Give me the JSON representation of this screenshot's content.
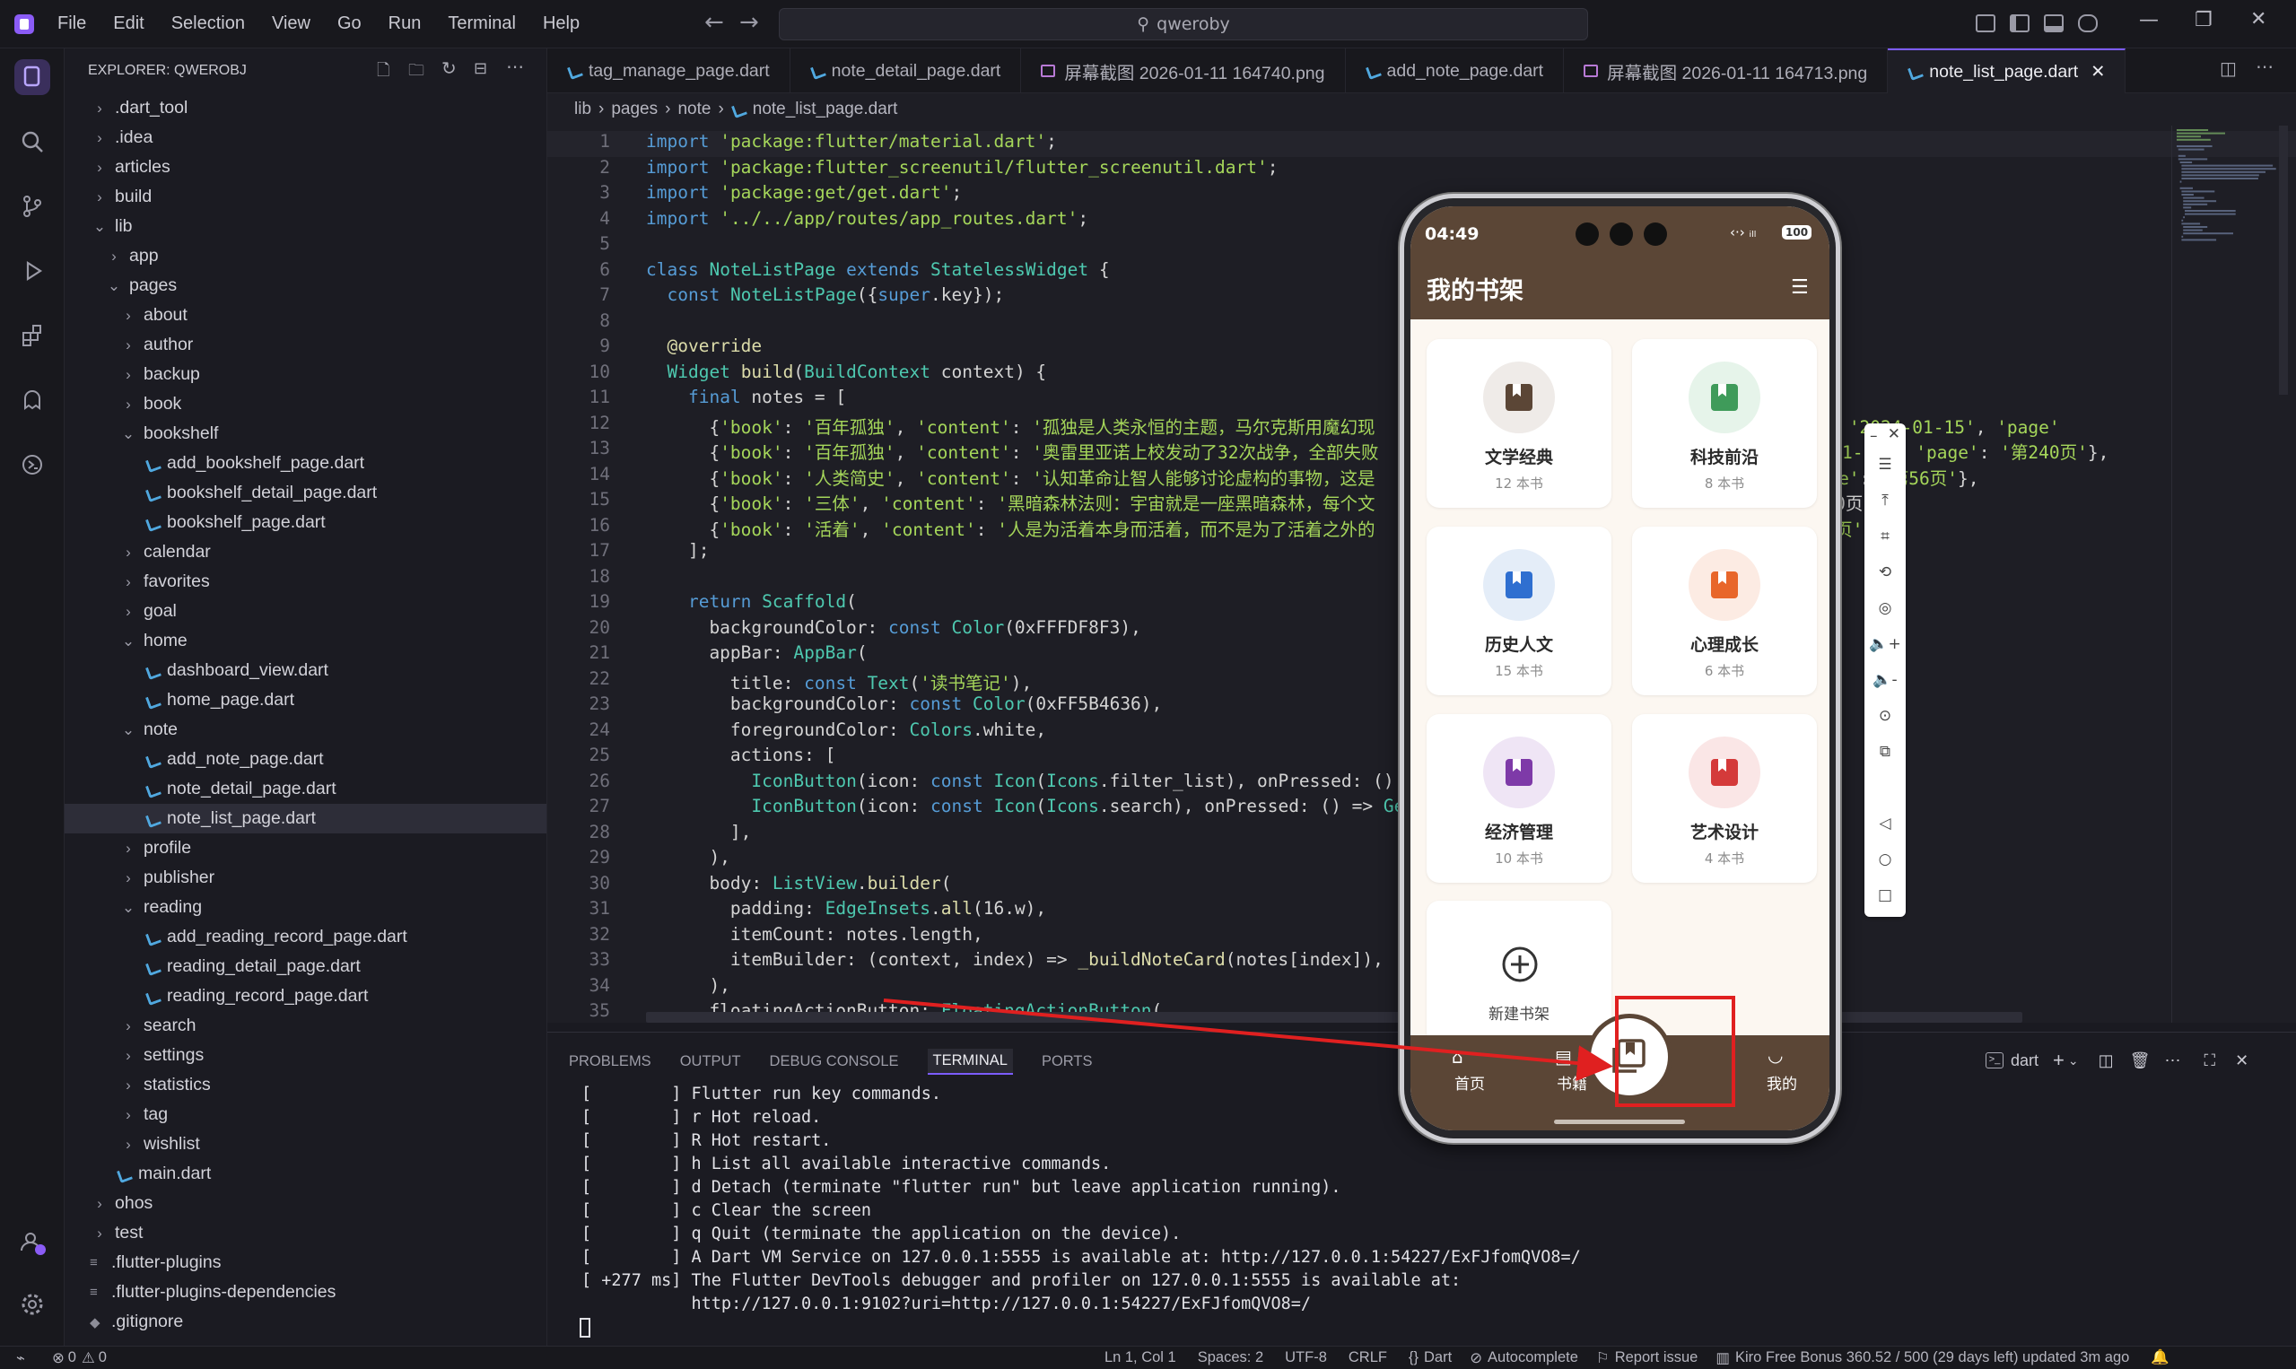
{
  "menu": [
    "File",
    "Edit",
    "Selection",
    "View",
    "Go",
    "Run",
    "Terminal",
    "Help"
  ],
  "search": {
    "text": "qweroby"
  },
  "explorer": {
    "title": "EXPLORER: QWEROBJ",
    "items": [
      {
        "label": ".dart_tool",
        "depth": 0,
        "type": "folder",
        "open": false
      },
      {
        "label": ".idea",
        "depth": 0,
        "type": "folder",
        "open": false
      },
      {
        "label": "articles",
        "depth": 0,
        "type": "folder",
        "open": false
      },
      {
        "label": "build",
        "depth": 0,
        "type": "folder",
        "open": false
      },
      {
        "label": "lib",
        "depth": 0,
        "type": "folder",
        "open": true
      },
      {
        "label": "app",
        "depth": 1,
        "type": "folder",
        "open": false
      },
      {
        "label": "pages",
        "depth": 1,
        "type": "folder",
        "open": true
      },
      {
        "label": "about",
        "depth": 2,
        "type": "folder",
        "open": false
      },
      {
        "label": "author",
        "depth": 2,
        "type": "folder",
        "open": false
      },
      {
        "label": "backup",
        "depth": 2,
        "type": "folder",
        "open": false
      },
      {
        "label": "book",
        "depth": 2,
        "type": "folder",
        "open": false
      },
      {
        "label": "bookshelf",
        "depth": 2,
        "type": "folder",
        "open": true
      },
      {
        "label": "add_bookshelf_page.dart",
        "depth": 3,
        "type": "dart"
      },
      {
        "label": "bookshelf_detail_page.dart",
        "depth": 3,
        "type": "dart"
      },
      {
        "label": "bookshelf_page.dart",
        "depth": 3,
        "type": "dart"
      },
      {
        "label": "calendar",
        "depth": 2,
        "type": "folder",
        "open": false
      },
      {
        "label": "favorites",
        "depth": 2,
        "type": "folder",
        "open": false
      },
      {
        "label": "goal",
        "depth": 2,
        "type": "folder",
        "open": false
      },
      {
        "label": "home",
        "depth": 2,
        "type": "folder",
        "open": true
      },
      {
        "label": "dashboard_view.dart",
        "depth": 3,
        "type": "dart"
      },
      {
        "label": "home_page.dart",
        "depth": 3,
        "type": "dart"
      },
      {
        "label": "note",
        "depth": 2,
        "type": "folder",
        "open": true
      },
      {
        "label": "add_note_page.dart",
        "depth": 3,
        "type": "dart"
      },
      {
        "label": "note_detail_page.dart",
        "depth": 3,
        "type": "dart"
      },
      {
        "label": "note_list_page.dart",
        "depth": 3,
        "type": "dart",
        "active": true
      },
      {
        "label": "profile",
        "depth": 2,
        "type": "folder",
        "open": false
      },
      {
        "label": "publisher",
        "depth": 2,
        "type": "folder",
        "open": false
      },
      {
        "label": "reading",
        "depth": 2,
        "type": "folder",
        "open": true
      },
      {
        "label": "add_reading_record_page.dart",
        "depth": 3,
        "type": "dart"
      },
      {
        "label": "reading_detail_page.dart",
        "depth": 3,
        "type": "dart"
      },
      {
        "label": "reading_record_page.dart",
        "depth": 3,
        "type": "dart"
      },
      {
        "label": "search",
        "depth": 2,
        "type": "folder",
        "open": false
      },
      {
        "label": "settings",
        "depth": 2,
        "type": "folder",
        "open": false
      },
      {
        "label": "statistics",
        "depth": 2,
        "type": "folder",
        "open": false
      },
      {
        "label": "tag",
        "depth": 2,
        "type": "folder",
        "open": false
      },
      {
        "label": "wishlist",
        "depth": 2,
        "type": "folder",
        "open": false
      },
      {
        "label": "main.dart",
        "depth": 1,
        "type": "dart"
      },
      {
        "label": "ohos",
        "depth": 0,
        "type": "folder",
        "open": false
      },
      {
        "label": "test",
        "depth": 0,
        "type": "folder",
        "open": false
      },
      {
        "label": ".flutter-plugins",
        "depth": 0,
        "type": "file"
      },
      {
        "label": ".flutter-plugins-dependencies",
        "depth": 0,
        "type": "file"
      },
      {
        "label": ".gitignore",
        "depth": 0,
        "type": "git"
      }
    ]
  },
  "tabs": [
    {
      "label": "tag_manage_page.dart",
      "type": "dart"
    },
    {
      "label": "note_detail_page.dart",
      "type": "dart"
    },
    {
      "label": "屏幕截图 2026-01-11 164740.png",
      "type": "image"
    },
    {
      "label": "add_note_page.dart",
      "type": "dart"
    },
    {
      "label": "屏幕截图 2026-01-11 164713.png",
      "type": "image"
    },
    {
      "label": "note_list_page.dart",
      "type": "dart",
      "active": true
    }
  ],
  "breadcrumb": [
    "lib",
    "pages",
    "note",
    "note_list_page.dart"
  ],
  "code": [
    "import 'package:flutter/material.dart';",
    "import 'package:flutter_screenutil/flutter_screenutil.dart';",
    "import 'package:get/get.dart';",
    "import '../../app/routes/app_routes.dart';",
    "",
    "class NoteListPage extends StatelessWidget {",
    "  const NoteListPage({super.key});",
    "",
    "  @override",
    "  Widget build(BuildContext context) {",
    "    final notes = [",
    "      {'book': '百年孤独', 'content': '孤独是人类永恒的主题，马尔克斯用魔幻现                                  ', 'date': '2024-01-15', 'page'",
    "      {'book': '百年孤独', 'content': '奥雷里亚诺上校发动了32次战争，全部失败                                  ', '2024-01-14', 'page': '第240页'},",
    "      {'book': '人类简史', 'content': '认知革命让智人能够讨论虚构的事物，这是                                  4-0', 'page': '第56页'},",
    "      {'book': '三体', 'content': '黑暗森林法则：宇宙就是一座黑暗森林，每个文                                  pag  '第320页'},",
    "      {'book': '活着', 'content': '人是为活着本身而活着，而不是为了活着之外的                                  ge   第180页'},",
    "    ];",
    "",
    "    return Scaffold(",
    "      backgroundColor: const Color(0xFFFDF8F3),",
    "      appBar: AppBar(",
    "        title: const Text('读书笔记'),",
    "        backgroundColor: const Color(0xFF5B4636),",
    "        foregroundColor: Colors.white,",
    "        actions: [",
    "          IconButton(icon: const Icon(Icons.filter_list), onPressed: () {",
    "          IconButton(icon: const Icon(Icons.search), onPressed: () => Get",
    "        ],",
    "      ),",
    "      body: ListView.builder(",
    "        padding: EdgeInsets.all(16.w),",
    "        itemCount: notes.length,",
    "        itemBuilder: (context, index) => _buildNoteCard(notes[index]),",
    "      ),",
    "      floatingActionButton: FloatingActionButton("
  ],
  "panel": {
    "tabs": [
      "PROBLEMS",
      "OUTPUT",
      "DEBUG CONSOLE",
      "TERMINAL",
      "PORTS"
    ],
    "active_tab": "TERMINAL",
    "shell": "dart",
    "terminal": [
      "[        ] Flutter run key commands.",
      "[        ] r Hot reload.",
      "[        ] R Hot restart.",
      "[        ] h List all available interactive commands.",
      "[        ] d Detach (terminate \"flutter run\" but leave application running).",
      "[        ] c Clear the screen",
      "[        ] q Quit (terminate the application on the device).",
      "[        ] A Dart VM Service on 127.0.0.1:5555 is available at: http://127.0.0.1:54227/ExFJfomQVO8=/",
      "[ +277 ms] The Flutter DevTools debugger and profiler on 127.0.0.1:5555 is available at:",
      "           http://127.0.0.1:9102?uri=http://127.0.0.1:54227/ExFJfomQVO8=/"
    ]
  },
  "phone": {
    "time": "04:49",
    "battery": "100",
    "title": "我的书架",
    "cards": [
      {
        "title": "文学经典",
        "count": "12 本书",
        "color": "#5b4636",
        "bg": "#efebe8"
      },
      {
        "title": "科技前沿",
        "count": "8 本书",
        "color": "#3f9b5a",
        "bg": "#e6f4ea"
      },
      {
        "title": "历史人文",
        "count": "15 本书",
        "color": "#2f6fd0",
        "bg": "#e4edf8"
      },
      {
        "title": "心理成长",
        "count": "6 本书",
        "color": "#e8662a",
        "bg": "#fcebe3"
      },
      {
        "title": "经济管理",
        "count": "10 本书",
        "color": "#7e3aa8",
        "bg": "#efe5f5"
      },
      {
        "title": "艺术设计",
        "count": "4 本书",
        "color": "#d43a3a",
        "bg": "#fae6e6"
      }
    ],
    "new_shelf": "新建书架",
    "nav": [
      "首页",
      "书籍",
      "",
      "我的"
    ]
  },
  "status": {
    "errors": "0",
    "warnings": "0",
    "position": "Ln 1, Col 1",
    "spaces": "Spaces: 2",
    "encoding": "UTF-8",
    "eol": "CRLF",
    "language": "Dart",
    "autocomplete": "Autocomplete",
    "report": "Report issue",
    "bonus": "Kiro Free Bonus 360.52 / 500 (29 days left) updated 3m ago"
  },
  "colors": {
    "accent": "#7c5cff",
    "phone_brown": "#5b4636",
    "phone_bg": "#fdf8f3",
    "annotation_red": "#e02020"
  }
}
